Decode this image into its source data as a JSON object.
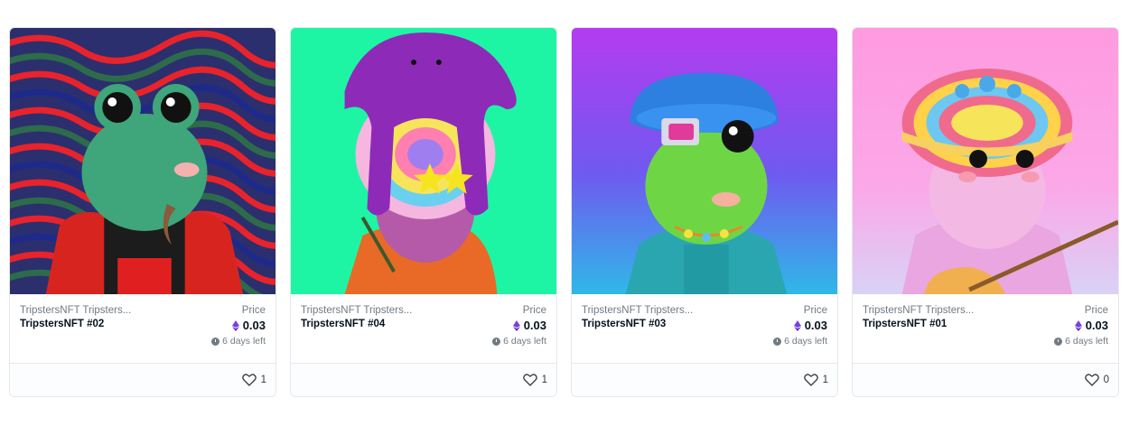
{
  "cards": [
    {
      "collection": "TripstersNFT Tripsters...",
      "name": "TripstersNFT #02",
      "price_label": "Price",
      "price": "0.03",
      "time_left": "6 days left",
      "likes": "1"
    },
    {
      "collection": "TripstersNFT Tripsters...",
      "name": "TripstersNFT #04",
      "price_label": "Price",
      "price": "0.03",
      "time_left": "6 days left",
      "likes": "1"
    },
    {
      "collection": "TripstersNFT Tripsters...",
      "name": "TripstersNFT #03",
      "price_label": "Price",
      "price": "0.03",
      "time_left": "6 days left",
      "likes": "1"
    },
    {
      "collection": "TripstersNFT Tripsters...",
      "name": "TripstersNFT #01",
      "price_label": "Price",
      "price": "0.03",
      "time_left": "6 days left",
      "likes": "0"
    }
  ],
  "icons": {
    "currency": "ethereum-icon",
    "timer": "clock-icon",
    "favorite": "heart-icon"
  },
  "colors": {
    "eth": "#7b3fe4",
    "muted": "#707a83",
    "text": "#04111d",
    "border": "#e5e8eb"
  }
}
